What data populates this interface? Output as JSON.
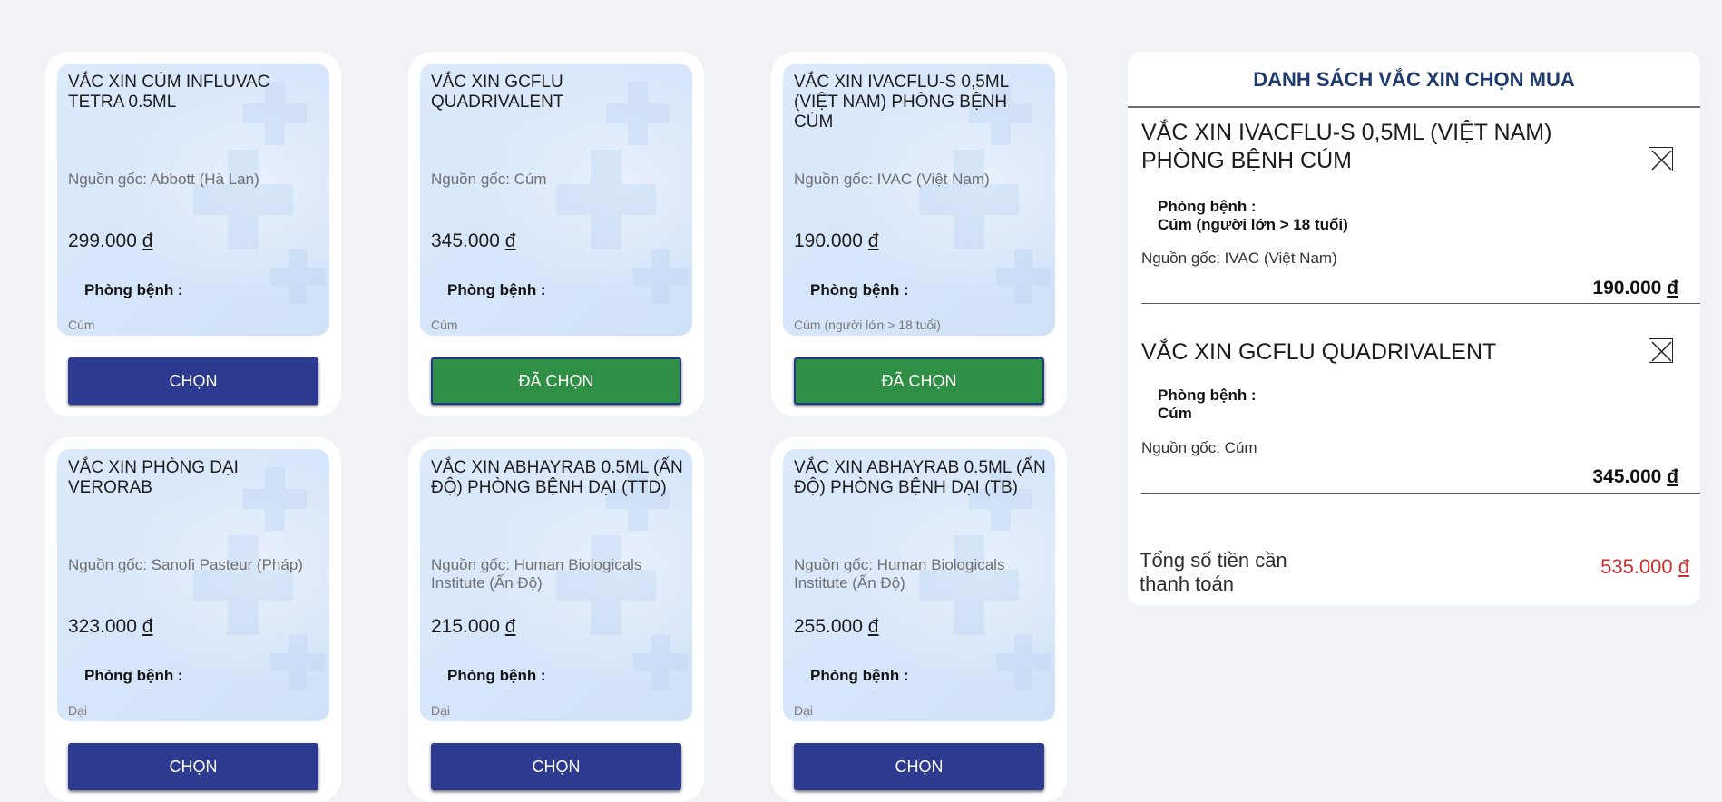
{
  "disease_label": "Phòng bệnh :",
  "currency": "đ",
  "vaccines": [
    {
      "name": "VẮC XIN CÚM INFLUVAC TETRA 0.5ML",
      "origin": "Nguồn gốc: Abbott (Hà Lan)",
      "price": "299.000",
      "disease": "Cúm",
      "button": "CHỌN",
      "selected": false
    },
    {
      "name": "VẮC XIN GCFLU QUADRIVALENT",
      "origin": "Nguồn gốc: Cúm",
      "price": "345.000",
      "disease": "Cúm",
      "button": "ĐÃ CHỌN",
      "selected": true
    },
    {
      "name": "VẮC XIN IVACFLU-S 0,5ML (VIỆT NAM) PHÒNG BỆNH CÚM",
      "origin": "Nguồn gốc: IVAC (Việt Nam)",
      "price": "190.000",
      "disease": "Cúm (người lớn > 18 tuổi)",
      "button": "ĐÃ CHỌN",
      "selected": true
    },
    {
      "name": "VẮC XIN PHÒNG DẠI VERORAB",
      "origin": "Nguồn gốc: Sanofi Pasteur (Pháp)",
      "price": "323.000",
      "disease": "Dại",
      "button": "CHỌN",
      "selected": false
    },
    {
      "name": "VẮC XIN ABHAYRAB 0.5ML (ẤN ĐỘ) PHÒNG BỆNH DẠI (TTD)",
      "origin": "Nguồn gốc: Human Biologicals Institute (Ấn Độ)",
      "price": "215.000",
      "disease": "Dại",
      "button": "CHỌN",
      "selected": false
    },
    {
      "name": "VẮC XIN ABHAYRAB 0.5ML (ẤN ĐỘ) PHÒNG BỆNH DẠI (TB)",
      "origin": "Nguồn gốc: Human Biologicals Institute (Ấn Độ)",
      "price": "255.000",
      "disease": "Dại",
      "button": "CHỌN",
      "selected": false
    }
  ],
  "cart": {
    "title": "DANH SÁCH VẮC XIN CHỌN MUA",
    "items": [
      {
        "name": "VẮC XIN IVACFLU-S 0,5ML (VIỆT NAM) PHÒNG BỆNH CÚM",
        "disease_label": "Phòng bệnh :",
        "disease": "Cúm (người lớn > 18 tuổi)",
        "origin": "Nguồn gốc: IVAC (Việt Nam)",
        "price": "190.000"
      },
      {
        "name": "VẮC XIN GCFLU QUADRIVALENT",
        "disease_label": "Phòng bệnh :",
        "disease": "Cúm",
        "origin": "Nguồn gốc: Cúm",
        "price": "345.000"
      }
    ],
    "total_label": "Tổng số tiền cần thanh toán",
    "total_value": "535.000",
    "total_color": "#cf2e2e"
  },
  "colors": {
    "select_button": "#2c3a8f",
    "selected_button": "#2f8f45",
    "title": "#1f3a6e"
  }
}
